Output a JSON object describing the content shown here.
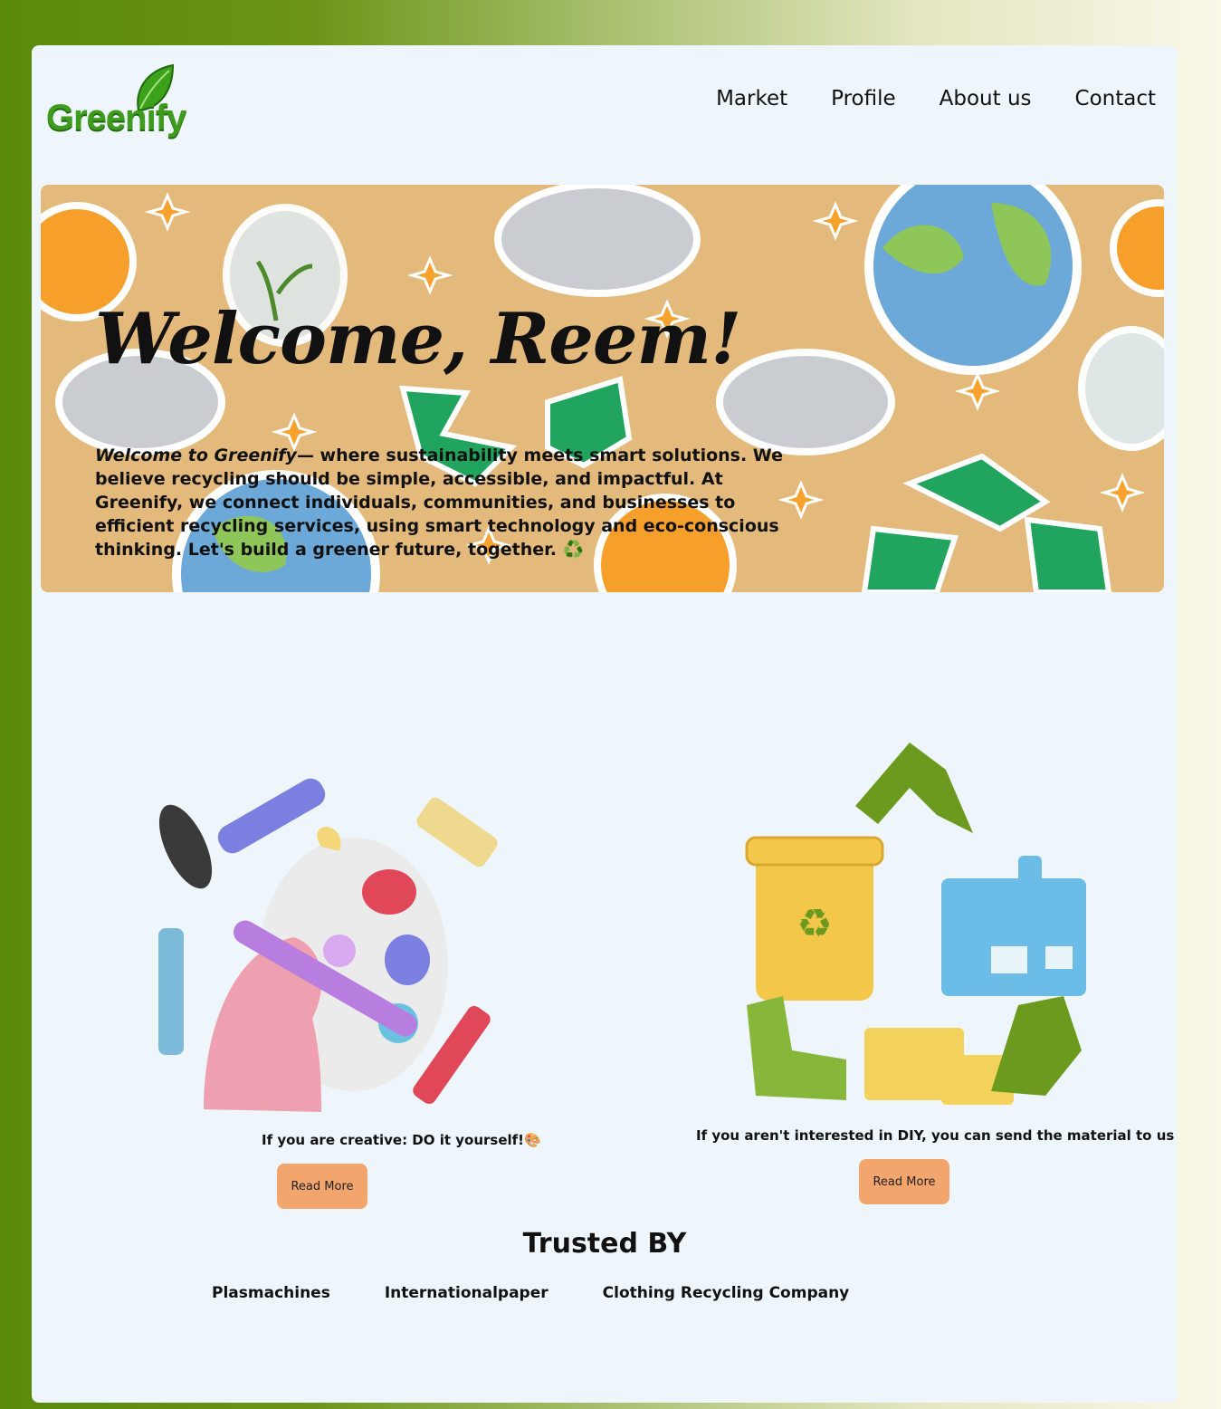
{
  "header": {
    "logo_text": "Greenify",
    "nav": [
      "Market",
      "Profile",
      "About us",
      "Contact"
    ]
  },
  "hero": {
    "title": "Welcome, Reem!",
    "lead": "Welcome to Greenify",
    "text": "— where sustainability meets smart solutions. We believe recycling should be simple, accessible, and impactful. At Greenify, we connect individuals, communities, and businesses to efficient recycling services, using smart technology and eco-conscious thinking. Let's build a greener future, together. ♻️"
  },
  "features": [
    {
      "caption": "If you are creative: DO it yourself!🎨",
      "button": "Read More",
      "icon": "art-palette-icon"
    },
    {
      "caption": "If you aren't interested in DIY, you can send the material to us",
      "button": "Read More",
      "icon": "recycling-factory-icon"
    }
  ],
  "trusted": {
    "title": "Trusted BY",
    "partners": [
      "Plasmachines",
      "Internationalpaper",
      "Clothing Recycling Company"
    ]
  },
  "colors": {
    "accent": "#f3a56e",
    "brand_green": "#3e9b1e",
    "card_bg": "#eef6fc"
  }
}
